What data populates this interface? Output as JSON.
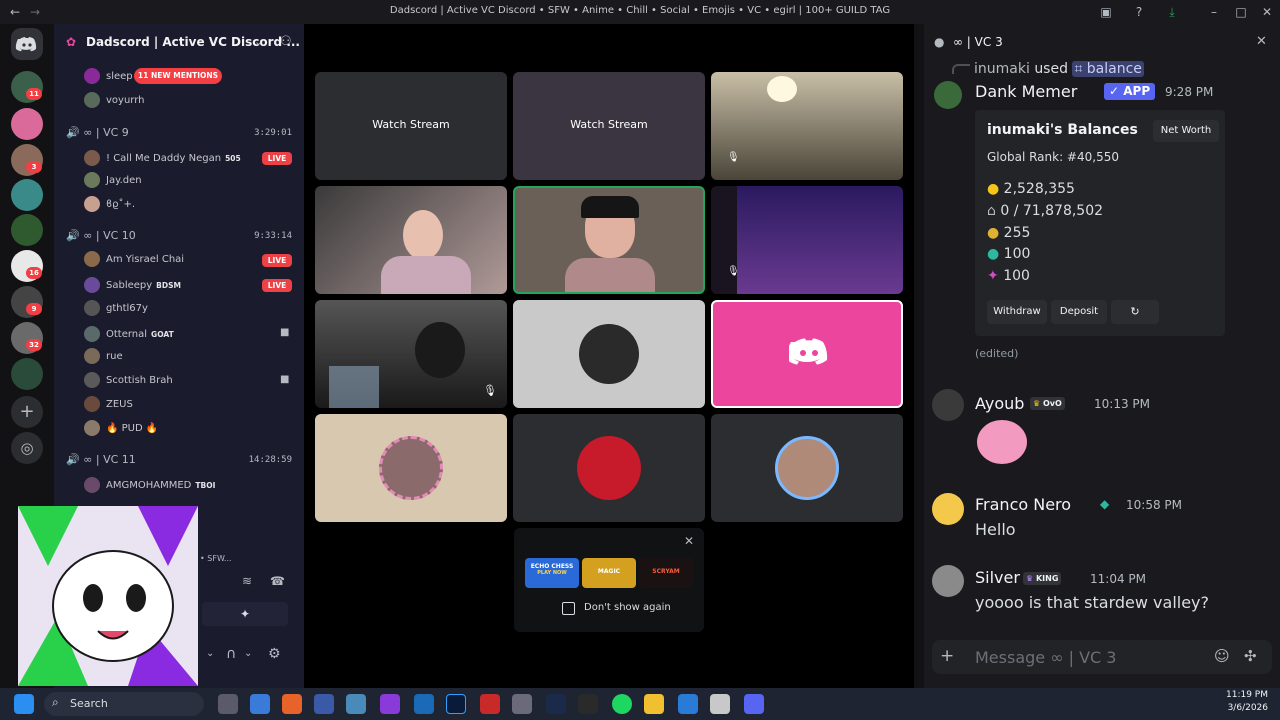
{
  "window": {
    "title": "Dadscord | Active VC Discord • SFW • Anime • Chill • Social • Emojis • VC • egirl | 100+ GUILD TAG"
  },
  "guild": {
    "name": "Dadscord | Active VC Discord ...",
    "new_mentions": "11 NEW MENTIONS"
  },
  "server_badges": [
    "11",
    "3",
    "16",
    "9",
    "32"
  ],
  "top_members": [
    "sleep",
    "voyurrh"
  ],
  "voice_channels": [
    {
      "name": "∞ | VC 9",
      "time": "3:29:01",
      "members": [
        {
          "name": "! Call Me Daddy Negan",
          "tag": "505",
          "live": "LIVE"
        },
        {
          "name": "Jay.den",
          "tag": "",
          "live": ""
        },
        {
          "name": "ϐϱ˚+.",
          "tag": "",
          "live": ""
        }
      ]
    },
    {
      "name": "∞ | VC 10",
      "time": "9:33:14",
      "members": [
        {
          "name": "Am Yisrael Chai",
          "tag": "",
          "live": "LIVE"
        },
        {
          "name": "Sableepy",
          "tag": "BDSM",
          "live": "LIVE"
        },
        {
          "name": "gthtl67y",
          "tag": "",
          "live": ""
        },
        {
          "name": "Otternal",
          "tag": "GOAT",
          "live": ""
        },
        {
          "name": "rue",
          "tag": "",
          "live": ""
        },
        {
          "name": "Scottish Brah",
          "tag": "",
          "live": ""
        },
        {
          "name": "ZEUS",
          "tag": "",
          "live": ""
        },
        {
          "name": "🔥 PUD 🔥",
          "tag": "",
          "live": ""
        }
      ]
    },
    {
      "name": "∞ | VC 11",
      "time": "14:28:59",
      "members": [
        {
          "name": "AMGMOHAMMED",
          "tag": "TBOI",
          "live": ""
        }
      ]
    }
  ],
  "user_panel": {
    "server_short": "• SFW..."
  },
  "stage": {
    "watch_stream": "Watch Stream",
    "popup": {
      "dont_show": "Don't show again",
      "games": [
        "ECHO CHESS",
        "MAGIC",
        "SCRYAM"
      ],
      "play_now": "PLAY NOW"
    }
  },
  "chat": {
    "channel": "∞ | VC 3",
    "reply": {
      "user": "inumaki",
      "used": "used",
      "command": "balance"
    },
    "bot": {
      "name": "Dank Memer",
      "badge": "APP",
      "time": "9:28 PM"
    },
    "embed": {
      "title": "inumaki's Balances",
      "net_worth_btn": "Net Worth",
      "rank": "Global Rank: #40,550",
      "values": [
        "2,528,355",
        "0 / 71,878,502",
        "255",
        "100",
        "100"
      ],
      "buttons": [
        "Withdraw",
        "Deposit"
      ]
    },
    "edited": "(edited)",
    "messages": [
      {
        "user": "Ayoub",
        "tag": "OvO",
        "time": "10:13 PM",
        "text": ""
      },
      {
        "user": "Franco Nero",
        "tag": "",
        "time": "10:58 PM",
        "text": "Hello"
      },
      {
        "user": "Silver",
        "tag": "KING",
        "time": "11:04 PM",
        "text": "yoooo is that stardew valley?"
      }
    ],
    "input_placeholder": "Message ∞ | VC 3"
  },
  "taskbar": {
    "search": "Search",
    "time": "11:19 PM",
    "date": "3/6/2026"
  },
  "colors": {
    "live": "#ed4245",
    "blurple": "#5865f2",
    "pink_tile": "#eb459e",
    "bg": "#121214"
  }
}
